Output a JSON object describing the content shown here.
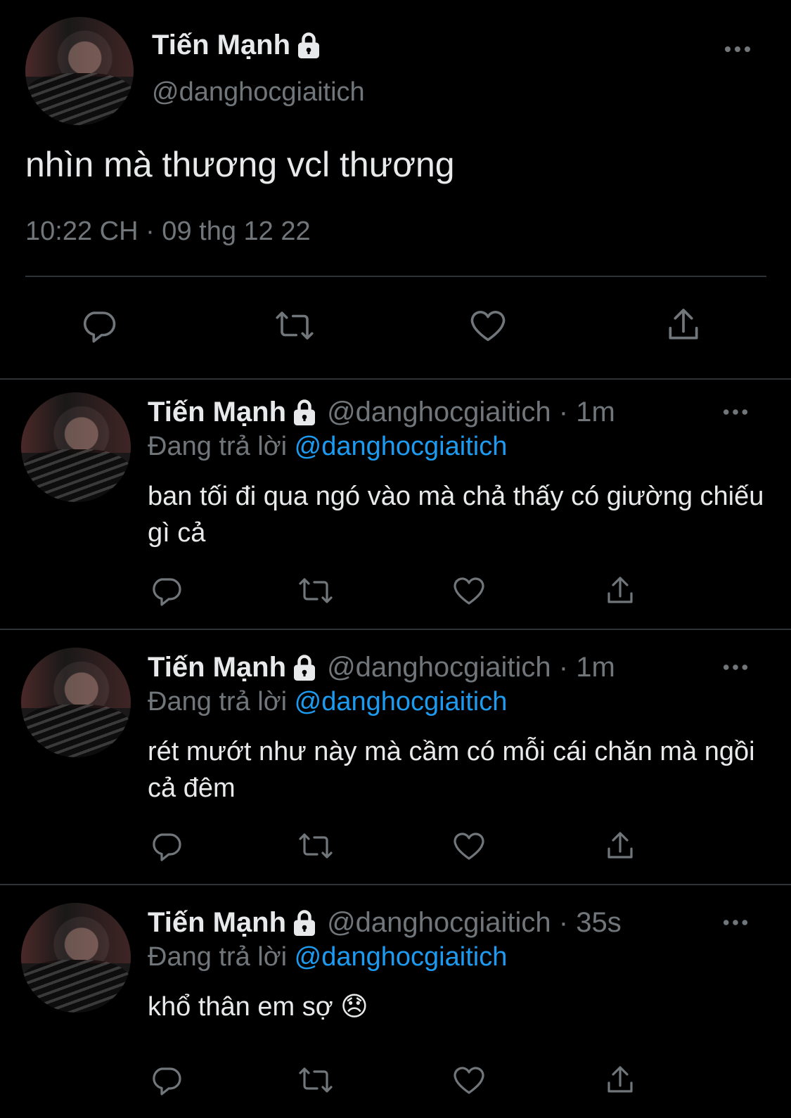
{
  "main_tweet": {
    "display_name": "Tiến Mạnh",
    "handle": "@danghocgiaitich",
    "text": "nhìn mà thương vcl thương",
    "timestamp": "10:22 CH · 09 thg 12 22",
    "icons": [
      "lock-icon",
      "more-icon",
      "reply-icon",
      "retweet-icon",
      "like-icon",
      "share-icon"
    ]
  },
  "replies": [
    {
      "display_name": "Tiến Mạnh",
      "handle_time": "@danghocgiaitich · 1m",
      "replying_label": "Đang trả lời",
      "replying_to": "@danghocgiaitich",
      "text": "ban tối đi qua ngó vào mà chả thấy có giường chiếu gì cả"
    },
    {
      "display_name": "Tiến Mạnh",
      "handle_time": "@danghocgiaitich · 1m",
      "replying_label": "Đang trả lời",
      "replying_to": "@danghocgiaitich",
      "text": "rét mướt như này mà cầm có mỗi cái chăn mà ngồi cả đêm"
    },
    {
      "display_name": "Tiến Mạnh",
      "handle_time": "@danghocgiaitich · 35s",
      "replying_label": "Đang trả lời",
      "replying_to": "@danghocgiaitich",
      "text": "khổ thân em sợ 😞"
    }
  ],
  "colors": {
    "background": "#000000",
    "text": "#e7e9ea",
    "secondary": "#71767b",
    "mention": "#1d9bf0",
    "divider": "#2f3336"
  }
}
